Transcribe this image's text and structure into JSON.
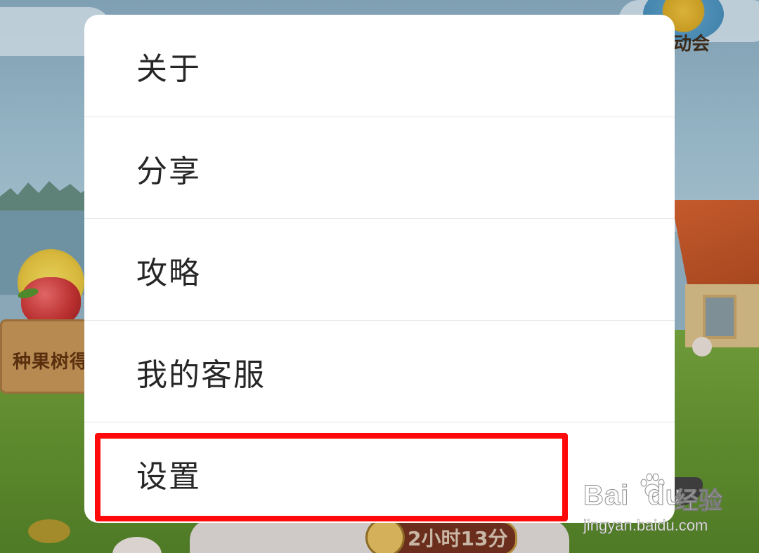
{
  "menu": {
    "items": [
      {
        "label": "关于"
      },
      {
        "label": "分享"
      },
      {
        "label": "攻略"
      },
      {
        "label": "我的客服"
      },
      {
        "label": "设置"
      }
    ],
    "highlighted_item": "设置"
  },
  "background": {
    "top_right_label": "动会",
    "box_label": "种果树得",
    "timer_text": "2小时13分"
  },
  "watermark": {
    "brand": "Bai",
    "brand_suffix": "du",
    "jingyan": "经验",
    "url": "jingyan.baidu.com"
  },
  "colors": {
    "highlight": "#ff0a0a",
    "menu_bg": "#ffffff",
    "menu_text": "#262626"
  }
}
